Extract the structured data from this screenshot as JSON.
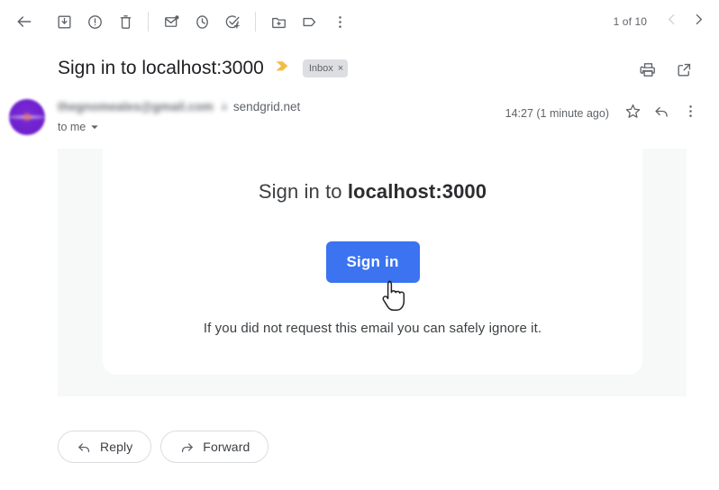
{
  "toolbar": {
    "back_label": "Back",
    "items": [
      {
        "name": "archive-icon",
        "label": "Archive"
      },
      {
        "name": "report-spam-icon",
        "label": "Report spam"
      },
      {
        "name": "delete-icon",
        "label": "Delete"
      },
      {
        "name": "mark-as-unread-icon",
        "label": "Mark as unread"
      },
      {
        "name": "snooze-icon",
        "label": "Snooze"
      },
      {
        "name": "add-to-tasks-icon",
        "label": "Add to tasks"
      },
      {
        "name": "move-to-icon",
        "label": "Move to"
      },
      {
        "name": "labels-icon",
        "label": "Labels"
      },
      {
        "name": "more-options-icon",
        "label": "More"
      }
    ],
    "page_count": "1 of 10",
    "prev_label": "Older",
    "next_label": "Newer"
  },
  "subject": {
    "title": "Sign in to localhost:3000",
    "importance_label": "Important",
    "chip_label": "Inbox",
    "chip_remove": "×",
    "print_label": "Print all",
    "open_new_label": "Open in new window"
  },
  "sender": {
    "email": "thegnomeales@gmail.com",
    "via_domain": "sendgrid.net",
    "recipient": "to me",
    "timestamp": "14:27 (1 minute ago)",
    "star_label": "Star",
    "reply_label": "Reply",
    "more_label": "More"
  },
  "email_body": {
    "heading_prefix": "Sign in to ",
    "heading_strong": "localhost:3000",
    "signin_button": "Sign in",
    "footnote": "If you did not request this email you can safely ignore it."
  },
  "footer": {
    "reply_label": "Reply",
    "forward_label": "Forward"
  },
  "colors": {
    "accent_button": "#3b73f0",
    "importance_marker": "#f5bb42",
    "chip_background": "#dddee1",
    "body_outer": "#f7f8f8",
    "text_primary": "#202124",
    "text_secondary": "#5f6368"
  }
}
